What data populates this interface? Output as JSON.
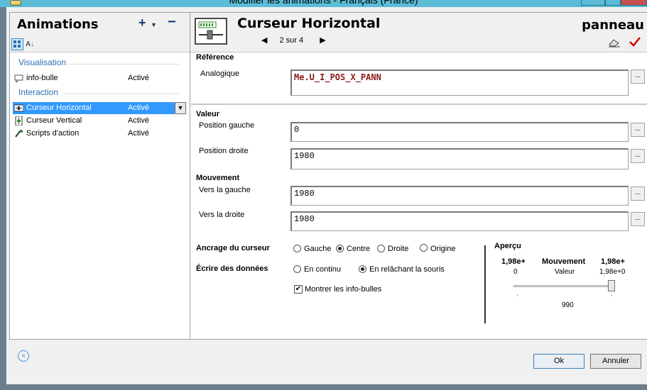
{
  "window": {
    "title": "Modifier les animations - Français (France)"
  },
  "left": {
    "title": "Animations",
    "add_label": "+",
    "remove_label": "−",
    "sort_label": "A↓",
    "sections": [
      {
        "name": "Visualisation",
        "items": [
          {
            "label": "info-bulle",
            "status": "Activé"
          }
        ]
      },
      {
        "name": "Interaction",
        "items": [
          {
            "label": "Curseur Horizontal",
            "status": "Activé",
            "selected": true
          },
          {
            "label": "Curseur Vertical",
            "status": "Activé"
          },
          {
            "label": "Scripts d'action",
            "status": "Activé"
          }
        ]
      }
    ]
  },
  "detail": {
    "title": "Curseur Horizontal",
    "nav": "2 sur 4",
    "object": "panneau",
    "reference": {
      "heading": "Référence",
      "label": "Analogique",
      "value": "Me.U_I_POS_X_PANN"
    },
    "valeur": {
      "heading": "Valeur",
      "left_label": "Position gauche",
      "left_value": "0",
      "right_label": "Position droite",
      "right_value": "1980"
    },
    "mouvement": {
      "heading": "Mouvement",
      "left_label": "Vers la gauche",
      "left_value": "1980",
      "right_label": "Vers la droite",
      "right_value": "1980"
    },
    "ancrage": {
      "label": "Ancrage du curseur",
      "options": [
        "Gauche",
        "Centre",
        "Droite",
        "Origine"
      ],
      "selected": "Centre"
    },
    "ecrire": {
      "label": "Écrire des données",
      "options": [
        "En continu",
        "En relâchant la souris"
      ],
      "selected": "En relâchant la souris"
    },
    "tooltips": {
      "label": "Montrer les info-bulles",
      "checked": true
    },
    "apercu": {
      "heading": "Aperçu",
      "left_top": "1,98e+",
      "mid_top": "Mouvement",
      "right_top": "1,98e+",
      "left_bottom": "0",
      "mid_bottom": "Valeur",
      "right_bottom": "1,98e+0",
      "slider_value": "990"
    }
  },
  "buttons": {
    "ok": "Ok",
    "cancel": "Annuler"
  },
  "colors": {
    "title_bar": "#5bbcd8",
    "selection": "#3399ff",
    "section_header": "#2b6fb0",
    "code_text": "#8b1a1a",
    "check_red": "#cc0000"
  }
}
